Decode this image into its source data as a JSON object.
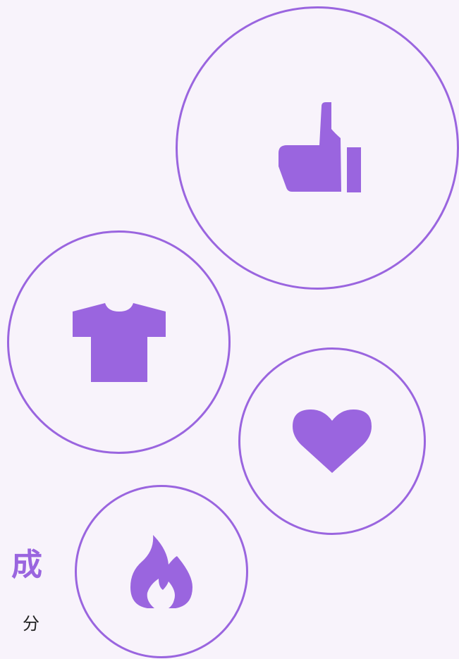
{
  "title_fragment": "成",
  "subtitle_fragment": "分",
  "accent_color": "#9a65df",
  "background_color": "#f8f3fb",
  "bubbles": [
    {
      "name": "like-bubble",
      "icon": "thumbs-up-icon"
    },
    {
      "name": "tshirt-bubble",
      "icon": "tshirt-icon"
    },
    {
      "name": "heart-bubble",
      "icon": "heart-icon"
    },
    {
      "name": "fire-bubble",
      "icon": "fire-icon"
    }
  ]
}
